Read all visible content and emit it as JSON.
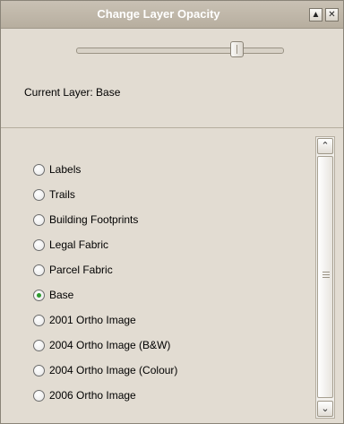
{
  "window": {
    "title": "Change Layer Opacity",
    "collapse_icon": "triangle-up-icon",
    "close_icon": "close-icon"
  },
  "opacity_slider": {
    "value_fraction": 0.78
  },
  "current_layer": {
    "label": "Current Layer: Base"
  },
  "layers": [
    {
      "label": "Labels",
      "selected": false
    },
    {
      "label": "Trails",
      "selected": false
    },
    {
      "label": "Building Footprints",
      "selected": false
    },
    {
      "label": "Legal Fabric",
      "selected": false
    },
    {
      "label": "Parcel Fabric",
      "selected": false
    },
    {
      "label": "Base",
      "selected": true
    },
    {
      "label": "2001 Ortho Image",
      "selected": false
    },
    {
      "label": "2004 Ortho Image (B&W)",
      "selected": false
    },
    {
      "label": "2004 Ortho Image (Colour)",
      "selected": false
    },
    {
      "label": "2006 Ortho Image",
      "selected": false
    }
  ],
  "colors": {
    "panel": "#e2dcd2",
    "accent_radio": "#2e9b2e"
  }
}
